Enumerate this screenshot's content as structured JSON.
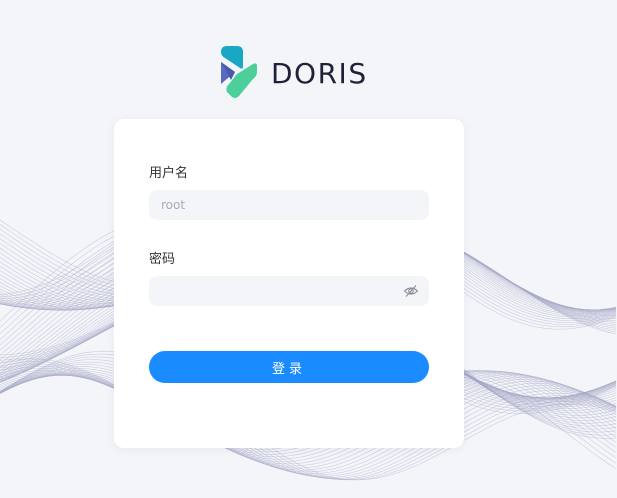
{
  "brand": {
    "name": "DORIS",
    "logo_icon": "doris-logo-icon"
  },
  "form": {
    "username_label": "用户名",
    "username_value": "",
    "username_placeholder": "root",
    "password_label": "密码",
    "password_value": "",
    "password_placeholder": "",
    "password_toggle_icon": "eye-off-icon",
    "submit_label": "登录"
  },
  "colors": {
    "background": "#f4f5f9",
    "primary": "#1a8cff",
    "input_bg": "#f4f5f9",
    "wave": "#a3a6c4",
    "logo_teal": "#14b3a8",
    "logo_green": "#4dcf9c",
    "logo_blue": "#5a6bbd"
  }
}
